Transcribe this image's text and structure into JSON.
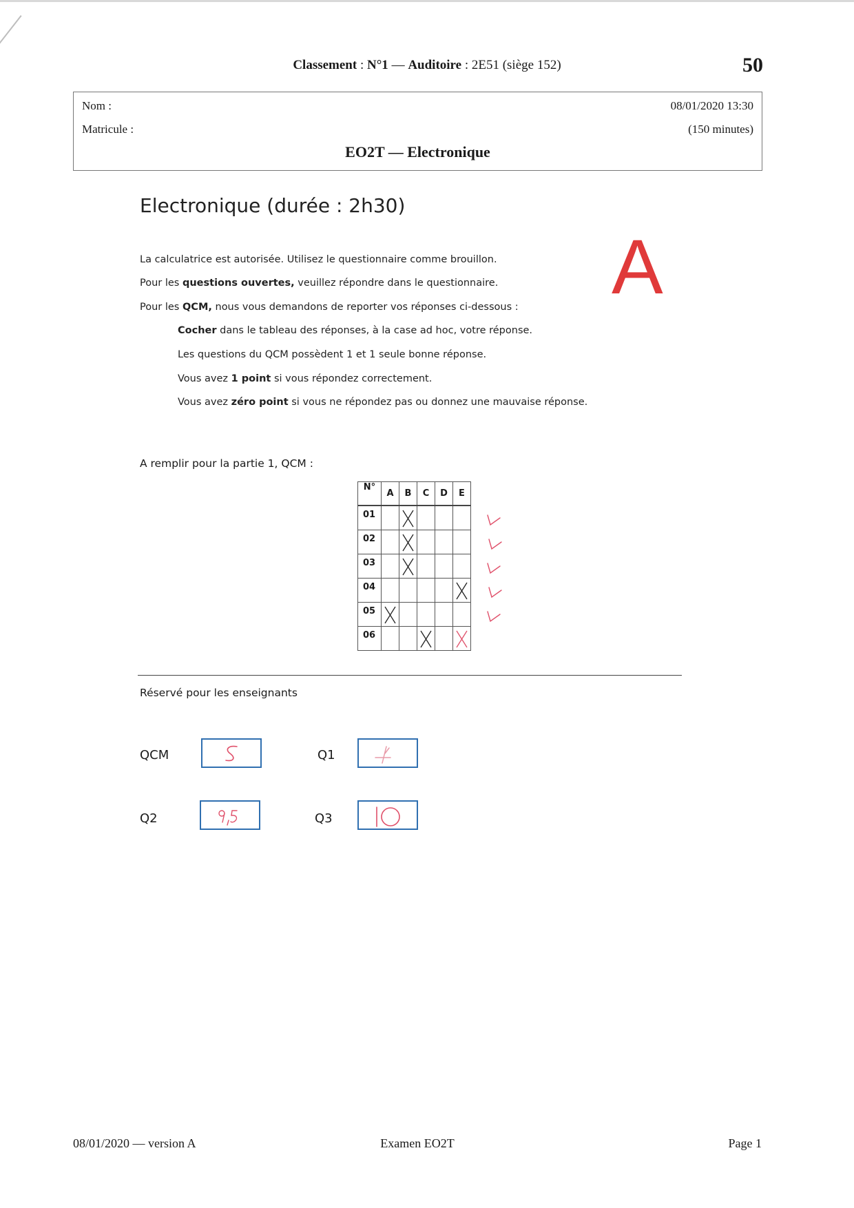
{
  "header": {
    "ranking_label": "Classement",
    "ranking_value": "N°1",
    "auditorium_label": "Auditoire",
    "auditorium_value": "2E51 (siège 152)",
    "page_number": "50"
  },
  "info_box": {
    "name_label": "Nom :",
    "student_id_label": "Matricule :",
    "datetime": "08/01/2020 13:30",
    "duration": "(150 minutes)",
    "course": "EO2T — Electronique"
  },
  "title": "Electronique (durée : 2h30)",
  "version_letter": "A",
  "instructions": {
    "line1": "La calculatrice est autorisée. Utilisez le questionnaire comme brouillon.",
    "line2_prefix": "Pour les ",
    "line2_bold": "questions ouvertes,",
    "line2_suffix": " veuillez répondre dans le questionnaire.",
    "line3_prefix": "Pour les ",
    "line3_bold": "QCM,",
    "line3_suffix": " nous vous demandons de reporter vos réponses ci-dessous :",
    "line4_bold": "Cocher",
    "line4_suffix": " dans le tableau des réponses, à la case ad hoc, votre réponse.",
    "line5": "Les questions du QCM possèdent 1 et 1 seule bonne réponse.",
    "line6_prefix": "Vous avez ",
    "line6_bold": "1 point",
    "line6_suffix": " si vous répondez correctement.",
    "line7_prefix": "Vous avez ",
    "line7_bold": "zéro point",
    "line7_suffix": " si vous ne répondez pas ou donnez une mauvaise réponse."
  },
  "qcm": {
    "label": "A remplir pour la partie 1, QCM :",
    "headers": [
      "N°",
      "A",
      "B",
      "C",
      "D",
      "E"
    ],
    "rows": [
      {
        "num": "01",
        "answer": "B",
        "grade": "correct"
      },
      {
        "num": "02",
        "answer": "B",
        "grade": "correct"
      },
      {
        "num": "03",
        "answer": "B",
        "grade": "correct"
      },
      {
        "num": "04",
        "answer": "E",
        "grade": "correct"
      },
      {
        "num": "05",
        "answer": "A",
        "grade": "correct"
      },
      {
        "num": "06",
        "answer": "C",
        "grade": "wrong",
        "correction": "E"
      }
    ],
    "colors": {
      "student_mark": "#222222",
      "grader_mark": "#e0506a"
    }
  },
  "reserved": {
    "label": "Réservé pour les enseignants",
    "scores": [
      {
        "label": "QCM",
        "value": "5"
      },
      {
        "label": "Q1",
        "value": "4"
      },
      {
        "label": "Q2",
        "value": "9,5"
      },
      {
        "label": "Q3",
        "value": "10"
      }
    ],
    "box_color": "#2f6fb0"
  },
  "footer": {
    "left": "08/01/2020 — version A",
    "center": "Examen EO2T",
    "right": "Page 1"
  }
}
